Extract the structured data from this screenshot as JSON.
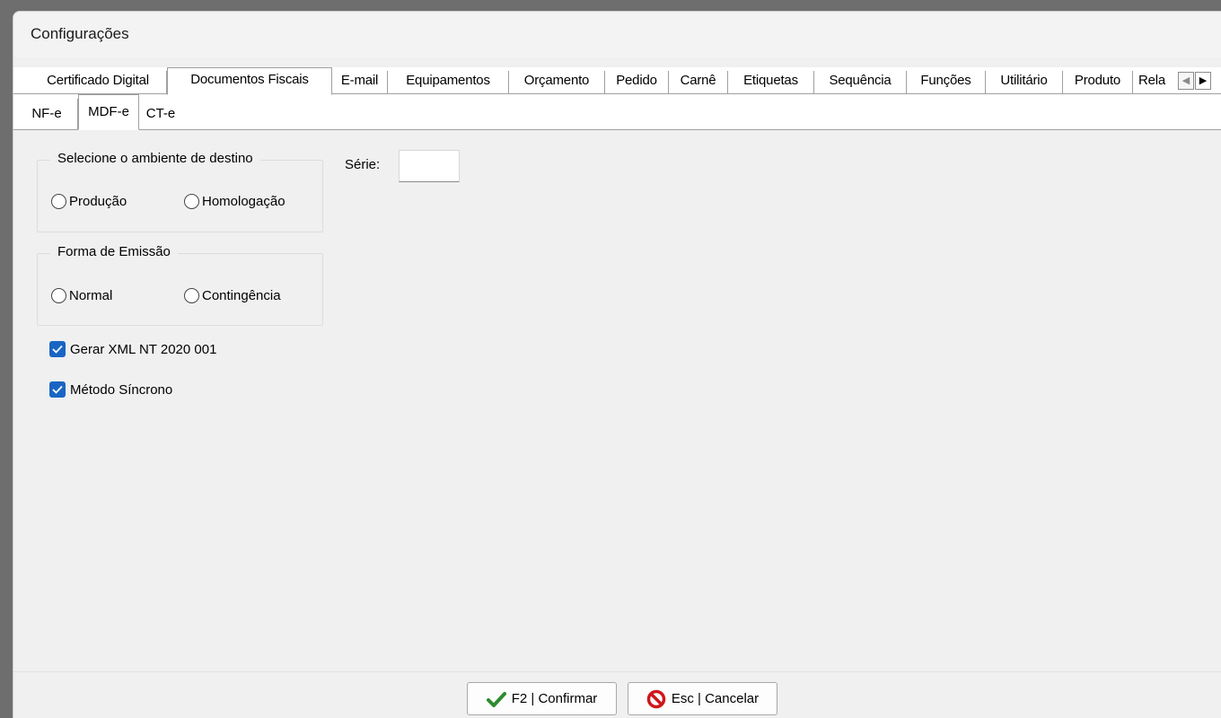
{
  "window": {
    "title": "Configurações"
  },
  "tabs": [
    {
      "label": "Certificado Digital"
    },
    {
      "label": "Documentos Fiscais"
    },
    {
      "label": "E-mail"
    },
    {
      "label": "Equipamentos"
    },
    {
      "label": "Orçamento"
    },
    {
      "label": "Pedido"
    },
    {
      "label": "Carnê"
    },
    {
      "label": "Etiquetas"
    },
    {
      "label": "Sequência"
    },
    {
      "label": "Funções"
    },
    {
      "label": "Utilitário"
    },
    {
      "label": "Produto"
    },
    {
      "label": "Rela"
    }
  ],
  "active_tab": "Documentos Fiscais",
  "subtabs": [
    {
      "label": "NF-e"
    },
    {
      "label": "MDF-e"
    },
    {
      "label": "CT-e"
    }
  ],
  "active_subtab": "MDF-e",
  "ambiente": {
    "legend": "Selecione o ambiente de destino",
    "options": [
      {
        "label": "Produção",
        "selected": false
      },
      {
        "label": "Homologação",
        "selected": false
      }
    ]
  },
  "emissao": {
    "legend": "Forma de Emissão",
    "options": [
      {
        "label": "Normal",
        "selected": false
      },
      {
        "label": "Contingência",
        "selected": false
      }
    ]
  },
  "serie": {
    "label": "Série:",
    "value": ""
  },
  "checkboxes": [
    {
      "label": "Gerar XML NT 2020 001",
      "checked": true
    },
    {
      "label": "Método Síncrono",
      "checked": true
    }
  ],
  "footer": {
    "confirm_label": "F2 | Confirmar",
    "cancel_label": "Esc | Cancelar"
  },
  "colors": {
    "checkbox_accent": "#1a65c4",
    "confirm_icon": "#2e8b2e",
    "cancel_icon": "#d0161b"
  }
}
